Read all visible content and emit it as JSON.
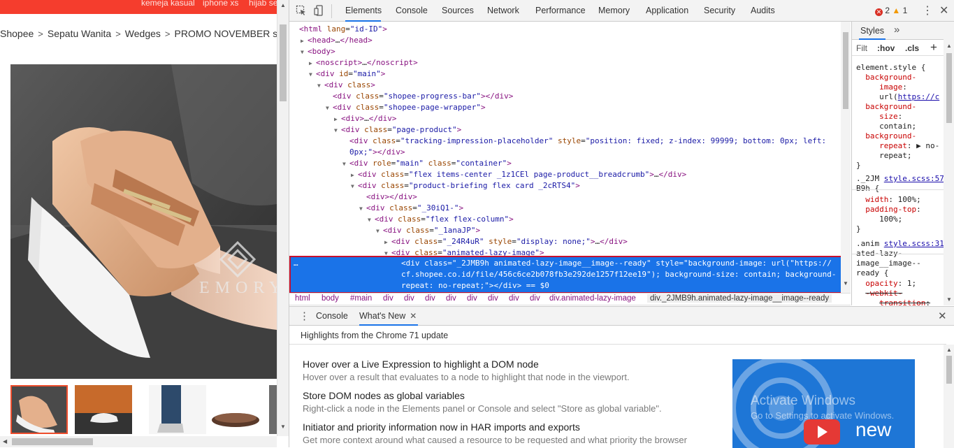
{
  "page": {
    "topbar_links": [
      "kemeja kasual",
      "iphone xs",
      "hijab se"
    ],
    "breadcrumb": [
      "Shopee",
      "Sepatu Wanita",
      "Wedges",
      "PROMO NOVEMBER sepat"
    ],
    "watermark_brand": "EMORY"
  },
  "devtools": {
    "tabs": [
      "Elements",
      "Console",
      "Sources",
      "Network",
      "Performance",
      "Memory",
      "Application",
      "Security",
      "Audits"
    ],
    "active_tab": "Elements",
    "errors": "2",
    "warnings": "1",
    "dom_lines": [
      {
        "indent": 0,
        "tri": "",
        "html": "<span class='tg'>&lt;html</span> <span class='an'>lang</span>=<span class='av'>\"id-ID\"</span><span class='tg'>&gt;</span>"
      },
      {
        "indent": 1,
        "tri": "▶",
        "html": "<span class='tg'>&lt;head&gt;</span>…<span class='tg'>&lt;/head&gt;</span>"
      },
      {
        "indent": 1,
        "tri": "▼",
        "html": "<span class='tg'>&lt;body&gt;</span>"
      },
      {
        "indent": 2,
        "tri": "▶",
        "html": "<span class='tg'>&lt;noscript&gt;</span>…<span class='tg'>&lt;/noscript&gt;</span>"
      },
      {
        "indent": 2,
        "tri": "▼",
        "html": "<span class='tg'>&lt;div</span> <span class='an'>id</span>=<span class='av'>\"main\"</span><span class='tg'>&gt;</span>"
      },
      {
        "indent": 3,
        "tri": "▼",
        "html": "<span class='tg'>&lt;div</span> <span class='an'>class</span><span class='tg'>&gt;</span>"
      },
      {
        "indent": 4,
        "tri": "",
        "html": "<span class='tg'>&lt;div</span> <span class='an'>class</span>=<span class='av'>\"shopee-progress-bar\"</span><span class='tg'>&gt;&lt;/div&gt;</span>"
      },
      {
        "indent": 4,
        "tri": "▼",
        "html": "<span class='tg'>&lt;div</span> <span class='an'>class</span>=<span class='av'>\"shopee-page-wrapper\"</span><span class='tg'>&gt;</span>"
      },
      {
        "indent": 5,
        "tri": "▶",
        "html": "<span class='tg'>&lt;div&gt;</span>…<span class='tg'>&lt;/div&gt;</span>"
      },
      {
        "indent": 5,
        "tri": "▼",
        "html": "<span class='tg'>&lt;div</span> <span class='an'>class</span>=<span class='av'>\"page-product\"</span><span class='tg'>&gt;</span>"
      },
      {
        "indent": 6,
        "tri": "",
        "html": "<span class='tg'>&lt;div</span> <span class='an'>class</span>=<span class='av'>\"tracking-impression-placeholder\"</span> <span class='an'>style</span>=<span class='av'>\"position: fixed; z-index: 99999; bottom: 0px; left:</span>"
      },
      {
        "indent": 6,
        "tri": "",
        "html": "<span class='av'>0px;\"</span><span class='tg'>&gt;&lt;/div&gt;</span>"
      },
      {
        "indent": 6,
        "tri": "▼",
        "html": "<span class='tg'>&lt;div</span> <span class='an'>role</span>=<span class='av'>\"main\"</span> <span class='an'>class</span>=<span class='av'>\"container\"</span><span class='tg'>&gt;</span>"
      },
      {
        "indent": 7,
        "tri": "▶",
        "html": "<span class='tg'>&lt;div</span> <span class='an'>class</span>=<span class='av'>\"flex items-center _1z1CEl page-product__breadcrumb\"</span><span class='tg'>&gt;</span>…<span class='tg'>&lt;/div&gt;</span>"
      },
      {
        "indent": 7,
        "tri": "▼",
        "html": "<span class='tg'>&lt;div</span> <span class='an'>class</span>=<span class='av'>\"product-briefing flex card _2cRTS4\"</span><span class='tg'>&gt;</span>"
      },
      {
        "indent": 8,
        "tri": "",
        "html": "<span class='tg'>&lt;div&gt;&lt;/div&gt;</span>"
      },
      {
        "indent": 8,
        "tri": "▼",
        "html": "<span class='tg'>&lt;div</span> <span class='an'>class</span>=<span class='av'>\"_30iQ1-\"</span><span class='tg'>&gt;</span>"
      },
      {
        "indent": 9,
        "tri": "▼",
        "html": "<span class='tg'>&lt;div</span> <span class='an'>class</span>=<span class='av'>\"flex flex-column\"</span><span class='tg'>&gt;</span>"
      },
      {
        "indent": 10,
        "tri": "▼",
        "html": "<span class='tg'>&lt;div</span> <span class='an'>class</span>=<span class='av'>\"_1anaJP\"</span><span class='tg'>&gt;</span>"
      },
      {
        "indent": 11,
        "tri": "▶",
        "html": "<span class='tg'>&lt;div</span> <span class='an'>class</span>=<span class='av'>\"_24R4uR\"</span> <span class='an'>style</span>=<span class='av'>\"display: none;\"</span><span class='tg'>&gt;</span>…<span class='tg'>&lt;/div&gt;</span>"
      },
      {
        "indent": 11,
        "tri": "▼",
        "html": "<span class='tg'>&lt;div</span> <span class='an'>class</span>=<span class='av'>\"animated-lazy-image\"</span><span class='tg'>&gt;</span>"
      }
    ],
    "selected_lines": [
      "<div class=\"_2JMB9h animated-lazy-image__image--ready\" style=\"background-image: url(\"https://",
      "cf.shopee.co.id/file/456c6ce2b078fb3e292de1257f12ee19\"); background-size: contain; background-",
      "repeat: no-repeat;\"></div> == $0"
    ],
    "crumbs": [
      "html",
      "body",
      "#main",
      "div",
      "div",
      "div",
      "div",
      "div",
      "div",
      "div",
      "div",
      "div.animated-lazy-image",
      "div._2JMB9h.animated-lazy-image__image--ready"
    ],
    "styles": {
      "tab": "Styles",
      "filter_placeholder": "Filt",
      "hov": ":hov",
      "cls": ".cls",
      "lines": [
        {
          "t": 90,
          "html": "element.style {"
        },
        {
          "t": 104,
          "html": "&nbsp;&nbsp;<span class='pn'>background-</span>"
        },
        {
          "t": 118,
          "html": "&nbsp;&nbsp;&nbsp;&nbsp;&nbsp;<span class='pn'>image</span>:"
        },
        {
          "t": 132,
          "html": "&nbsp;&nbsp;&nbsp;&nbsp;&nbsp;url(<span class='lk'>https://c</span>"
        },
        {
          "t": 146,
          "html": "&nbsp;&nbsp;<span class='pn'>background-</span>"
        },
        {
          "t": 160,
          "html": "&nbsp;&nbsp;&nbsp;&nbsp;&nbsp;<span class='pn'>size</span>:"
        },
        {
          "t": 174,
          "html": "&nbsp;&nbsp;&nbsp;&nbsp;&nbsp;contain;"
        },
        {
          "t": 188,
          "html": "&nbsp;&nbsp;<span class='pn'>background-</span>"
        },
        {
          "t": 202,
          "html": "&nbsp;&nbsp;&nbsp;&nbsp;&nbsp;<span class='pn'>repeat</span>: ▶ no-"
        },
        {
          "t": 216,
          "html": "&nbsp;&nbsp;&nbsp;&nbsp;&nbsp;repeat;"
        },
        {
          "t": 230,
          "html": "}"
        },
        {
          "t": 249,
          "html": "._2JM <span class='lk'>style.scss:57</span>"
        },
        {
          "t": 263,
          "html": "B9h {"
        },
        {
          "t": 279,
          "html": "&nbsp;&nbsp;<span class='pn'>width</span>: 100%;"
        },
        {
          "t": 293,
          "html": "&nbsp;&nbsp;<span class='pn'>padding-top</span>:"
        },
        {
          "t": 307,
          "html": "&nbsp;&nbsp;&nbsp;&nbsp;&nbsp;100%;"
        },
        {
          "t": 321,
          "html": "}"
        },
        {
          "t": 342,
          "html": ".anim <span class='lk'>style.scss:31</span>"
        },
        {
          "t": 356,
          "html": "ated-lazy-"
        },
        {
          "t": 370,
          "html": "image__image--"
        },
        {
          "t": 384,
          "html": "ready {"
        },
        {
          "t": 399,
          "html": "&nbsp;&nbsp;<span class='pn'>opacity</span>: 1;"
        },
        {
          "t": 413,
          "html": "&nbsp;&nbsp;<s><span class='pn'>-webkit-</span></s>"
        },
        {
          "t": 427,
          "html": "&nbsp;&nbsp;&nbsp;&nbsp;&nbsp;<s><span class='pn'>transition</span>:</s>"
        }
      ]
    },
    "drawer": {
      "tabs": [
        "Console",
        "What's New"
      ],
      "active": "What's New",
      "heading": "Highlights from the Chrome 71 update",
      "items": [
        {
          "title": "Hover over a Live Expression to highlight a DOM node",
          "desc": "Hover over a result that evaluates to a node to highlight that node in the viewport."
        },
        {
          "title": "Store DOM nodes as global variables",
          "desc": "Right-click a node in the Elements panel or Console and select \"Store as global variable\"."
        },
        {
          "title": "Initiator and priority information now in HAR imports and exports",
          "desc": "Get more context around what caused a resource to be requested and what priority the browser"
        }
      ],
      "watermark_line1": "Activate Windows",
      "watermark_line2": "Go to Settings to activate Windows.",
      "card_new": "new"
    }
  }
}
